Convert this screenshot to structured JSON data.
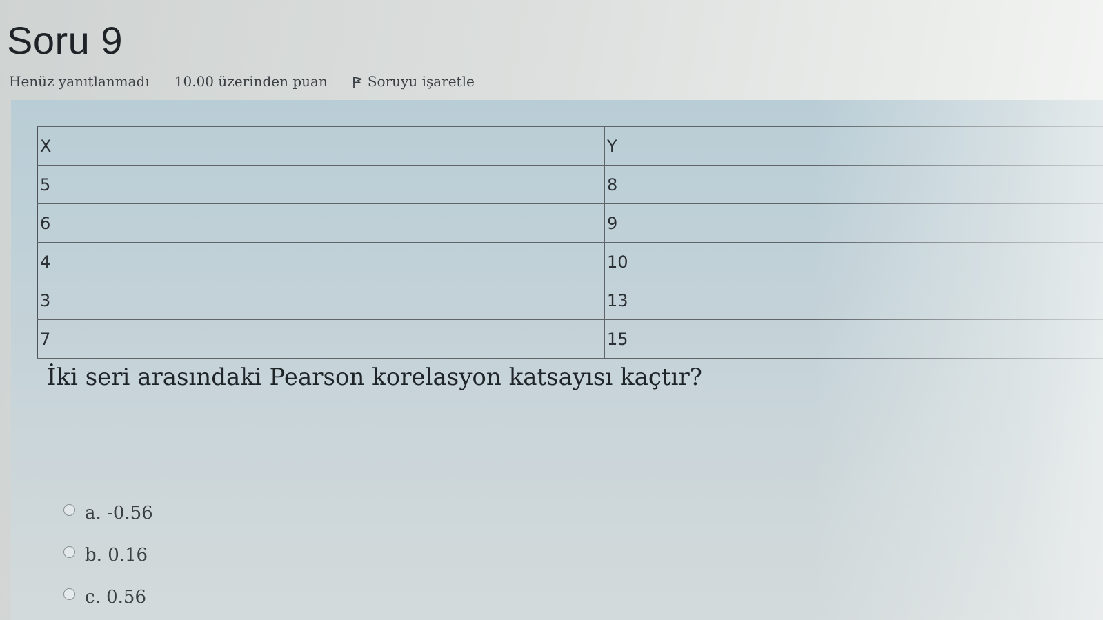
{
  "question": {
    "title": "Soru 9",
    "status": "Henüz yanıtlanmadı",
    "grade": "10.00 üzerinden puan",
    "flag_label": "Soruyu işaretle",
    "text": "İki seri arasındaki Pearson korelasyon katsayısı kaçtır?"
  },
  "table": {
    "headers": [
      "X",
      "Y"
    ],
    "rows": [
      [
        "5",
        "8"
      ],
      [
        "6",
        "9"
      ],
      [
        "4",
        "10"
      ],
      [
        "3",
        "13"
      ],
      [
        "7",
        "15"
      ]
    ]
  },
  "options": [
    {
      "letter": "a.",
      "value": "-0.56"
    },
    {
      "letter": "b.",
      "value": "0.16"
    },
    {
      "letter": "c.",
      "value": "0.56"
    }
  ]
}
